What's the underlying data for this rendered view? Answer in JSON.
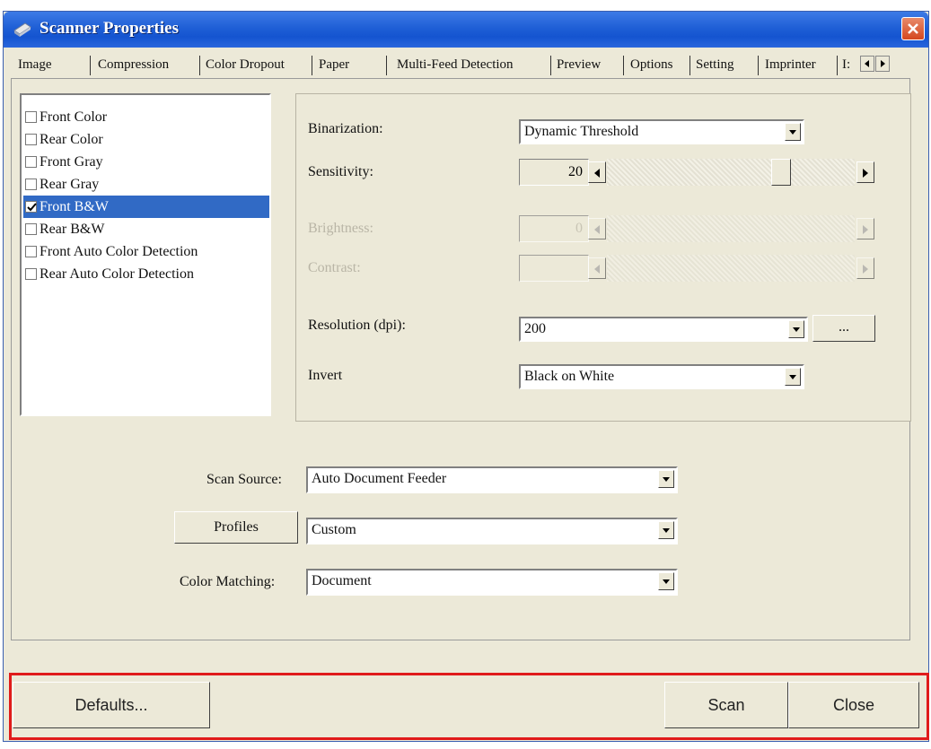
{
  "window": {
    "title": "Scanner Properties"
  },
  "tabs": [
    "Image",
    "Compression",
    "Color Dropout",
    "Paper",
    "Multi-Feed Detection",
    "Preview",
    "Options",
    "Setting",
    "Imprinter",
    "I:"
  ],
  "image_list": [
    {
      "label": "Front Color",
      "checked": false
    },
    {
      "label": "Rear Color",
      "checked": false
    },
    {
      "label": "Front Gray",
      "checked": false
    },
    {
      "label": "Rear Gray",
      "checked": false
    },
    {
      "label": "Front B&W",
      "checked": true,
      "selected": true
    },
    {
      "label": "Rear B&W",
      "checked": false
    },
    {
      "label": "Front Auto Color Detection",
      "checked": false
    },
    {
      "label": "Rear Auto Color Detection",
      "checked": false
    }
  ],
  "settings": {
    "binarization": {
      "label": "Binarization:",
      "value": "Dynamic Threshold"
    },
    "sensitivity": {
      "label": "Sensitivity:",
      "value": "20",
      "level": 0.72
    },
    "brightness": {
      "label": "Brightness:",
      "value": "0"
    },
    "contrast": {
      "label": "Contrast:",
      "value": ""
    },
    "resolution": {
      "label": "Resolution (dpi):",
      "value": "200",
      "more_label": "..."
    },
    "invert": {
      "label": "Invert",
      "value": "Black on White"
    }
  },
  "lower": {
    "scan_source": {
      "label": "Scan Source:",
      "value": "Auto Document Feeder"
    },
    "profiles": {
      "button_label": "Profiles",
      "value": "Custom"
    },
    "color_matching": {
      "label": "Color Matching:",
      "value": "Document"
    }
  },
  "buttons": {
    "defaults": "Defaults...",
    "scan": "Scan",
    "close": "Close"
  },
  "colors": {
    "selection": "#316ac5",
    "highlight_border": "#e01b1b",
    "titlebar": "#1f5fd6"
  }
}
